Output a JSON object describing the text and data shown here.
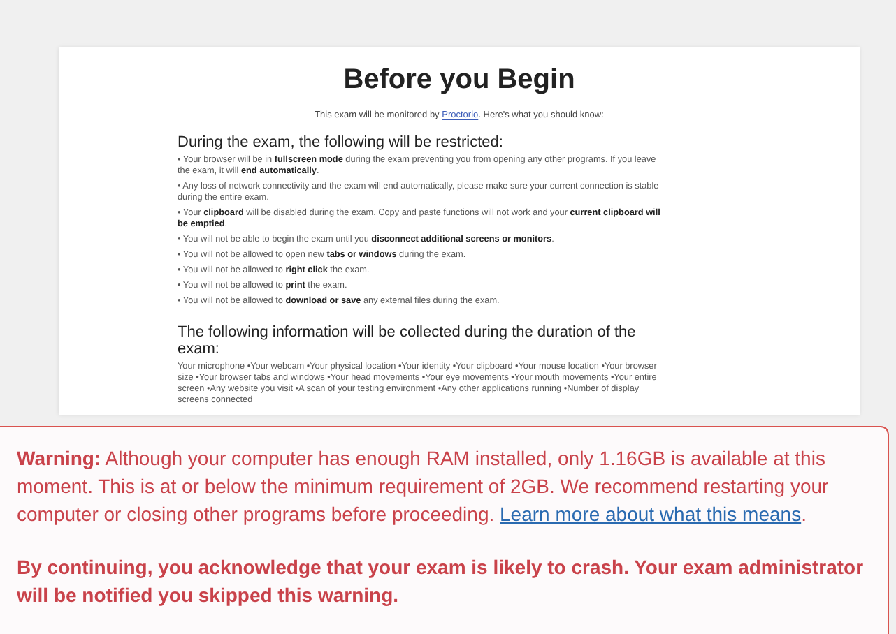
{
  "card": {
    "title": "Before you Begin",
    "intro": {
      "before": "This exam will be monitored by ",
      "link": "Proctorio",
      "after": ". Here's what you should know:"
    },
    "restricted": {
      "heading": "During the exam, the following will be restricted:",
      "items": [
        "• Your browser will be in **fullscreen mode** during the exam preventing you from opening any other programs. If you leave the exam, it will **end automatically**.",
        "• Any loss of network connectivity and the exam will end automatically, please make sure your current connection is stable during the entire exam.",
        "• Your **clipboard** will be disabled during the exam. Copy and paste functions will not work and your **current clipboard will be emptied**.",
        "• You will not be able to begin the exam until you **disconnect additional screens or monitors**.",
        "• You will not be allowed to open new **tabs or windows** during the exam.",
        "• You will not be allowed to **right click** the exam.",
        "• You will not be allowed to **print** the exam.",
        "• You will not be allowed to **download or save** any external files during the exam."
      ]
    },
    "collected": {
      "heading": "The following information will be collected during the duration of the exam:",
      "text": "Your microphone •Your webcam •Your physical location •Your identity •Your clipboard •Your mouse location •Your browser size •Your browser tabs and windows •Your head movements •Your eye movements •Your mouth movements •Your entire screen •Any website you visit •A scan of your testing environment •Any other applications running •Number of display screens connected"
    }
  },
  "warning": {
    "label": "Warning:",
    "text": " Although your computer has enough RAM installed, only 1.16GB is available at this moment. This is at or below the minimum requirement of 2GB. We recommend restarting your computer or closing other programs before proceeding. ",
    "link": "Learn more about what this means",
    "after": ".",
    "notice": "By continuing, you acknowledge that your exam is likely to crash. Your exam administrator will be notified you skipped this warning."
  }
}
